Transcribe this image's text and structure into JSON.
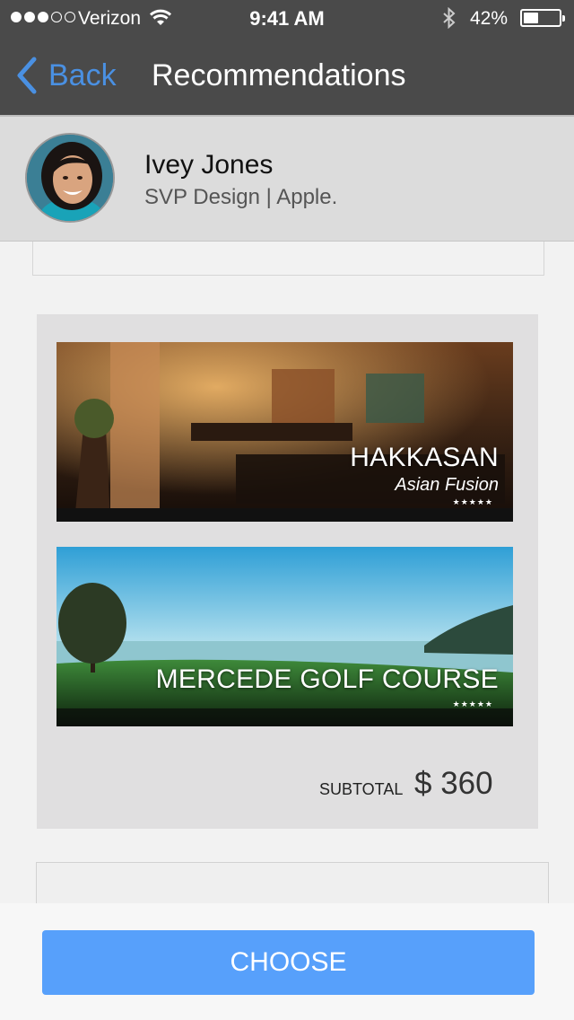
{
  "status_bar": {
    "carrier": "Verizon",
    "time": "9:41 AM",
    "battery": "42%",
    "battery_level": 0.42
  },
  "nav": {
    "back_label": "Back",
    "title": "Recommendations"
  },
  "profile": {
    "name": "Ivey Jones",
    "role": "SVP Design | Apple."
  },
  "recommendations": [
    {
      "name": "HAKKASAN",
      "category": "Asian Fusion",
      "rating": "★★★★★"
    },
    {
      "name": "MERCEDE GOLF COURSE",
      "rating": "★★★★★"
    }
  ],
  "subtotal": {
    "label": "SUBTOTAL",
    "value": "$ 360"
  },
  "actions": {
    "choose_label": "CHOOSE"
  },
  "colors": {
    "nav_bg": "#4a4a4a",
    "accent": "#4a90e2",
    "button": "#57a0fb"
  }
}
